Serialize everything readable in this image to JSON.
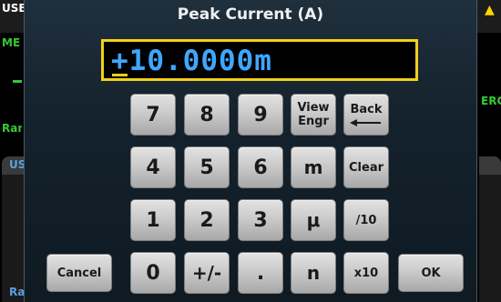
{
  "background": {
    "top_left_label": "USB",
    "meas_label": "ME",
    "range_label": "Ran",
    "right_label": "ERC",
    "panel_left_title": "US",
    "bottom_label": "Ra",
    "warning_icon": "warning-icon"
  },
  "dialog": {
    "title": "Peak Current (A)"
  },
  "entry": {
    "value": "+10.0000m"
  },
  "keypad": {
    "row1": [
      "7",
      "8",
      "9"
    ],
    "view_engr": [
      "View",
      "Engr"
    ],
    "back": "Back",
    "row2": [
      "4",
      "5",
      "6",
      "m"
    ],
    "clear": "Clear",
    "row3": [
      "1",
      "2",
      "3",
      "μ"
    ],
    "div10": "/10",
    "row4": [
      "0",
      "+/-",
      ".",
      "n"
    ],
    "x10": "x10",
    "cancel": "Cancel",
    "ok": "OK"
  },
  "colors": {
    "entry_text": "#3ea7ff",
    "entry_border": "#f2cf1c",
    "status_green": "#37c837",
    "warning_yellow": "#ffd400"
  }
}
